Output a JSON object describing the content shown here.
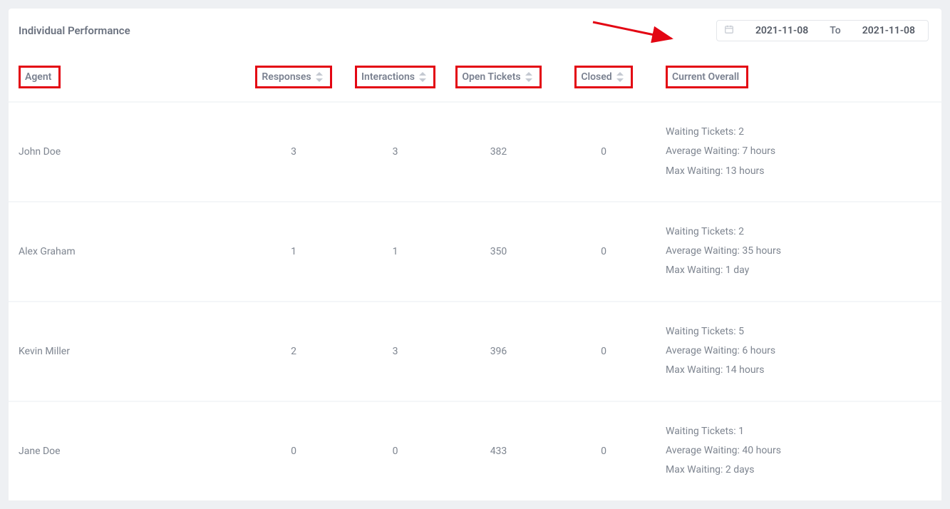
{
  "header": {
    "title": "Individual Performance"
  },
  "date_range": {
    "from": "2021-11-08",
    "to_label": "To",
    "to": "2021-11-08"
  },
  "columns": {
    "agent": "Agent",
    "responses": "Responses",
    "interactions": "Interactions",
    "open_tickets": "Open Tickets",
    "closed": "Closed",
    "current_overall": "Current Overall"
  },
  "overall_labels": {
    "waiting_tickets": "Waiting Tickets:",
    "avg_waiting": "Average Waiting:",
    "max_waiting": "Max Waiting:"
  },
  "rows": [
    {
      "agent": "John Doe",
      "responses": "3",
      "interactions": "3",
      "open_tickets": "382",
      "closed": "0",
      "waiting_tickets": "2",
      "avg_waiting": "7 hours",
      "max_waiting": "13 hours"
    },
    {
      "agent": "Alex Graham",
      "responses": "1",
      "interactions": "1",
      "open_tickets": "350",
      "closed": "0",
      "waiting_tickets": "2",
      "avg_waiting": "35 hours",
      "max_waiting": "1 day"
    },
    {
      "agent": "Kevin Miller",
      "responses": "2",
      "interactions": "3",
      "open_tickets": "396",
      "closed": "0",
      "waiting_tickets": "5",
      "avg_waiting": "6 hours",
      "max_waiting": "14 hours"
    },
    {
      "agent": "Jane Doe",
      "responses": "0",
      "interactions": "0",
      "open_tickets": "433",
      "closed": "0",
      "waiting_tickets": "1",
      "avg_waiting": "40 hours",
      "max_waiting": "2 days"
    }
  ]
}
